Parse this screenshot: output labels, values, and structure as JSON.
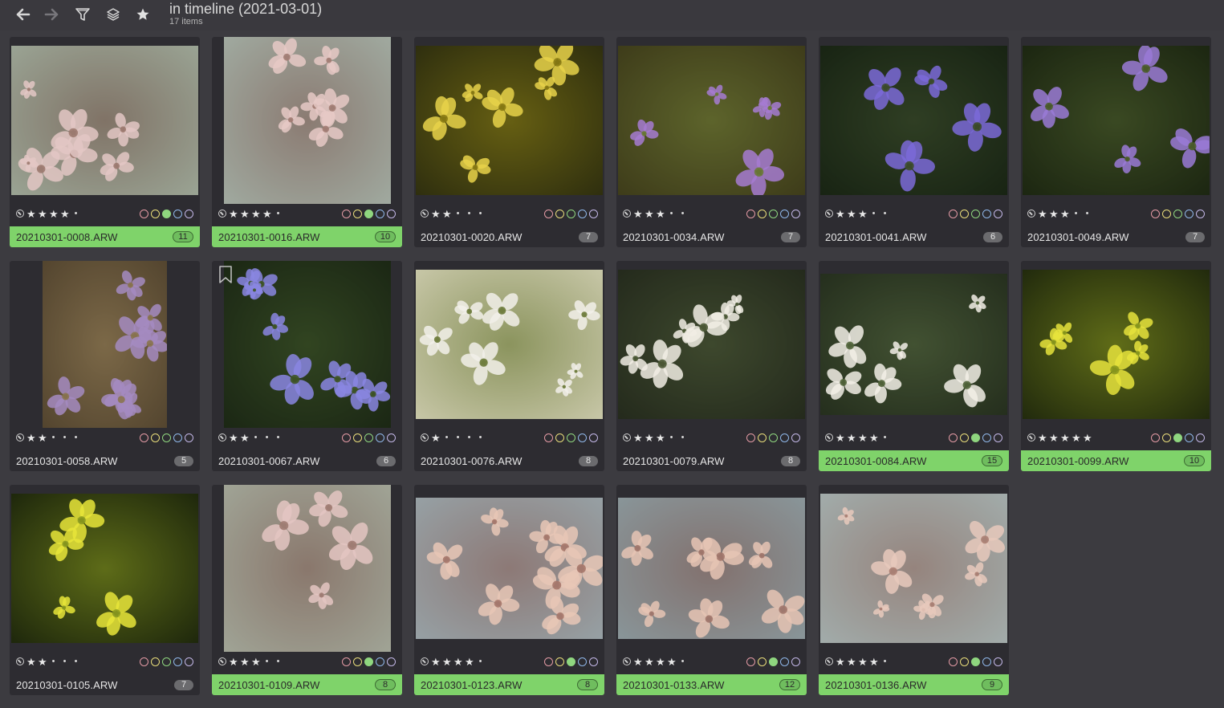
{
  "toolbar": {
    "title": "in timeline (2021-03-01)",
    "count": "17 items",
    "buttons": [
      "back-icon",
      "forward-icon",
      "filter-icon",
      "stack-icon",
      "star-icon"
    ]
  },
  "colors": {
    "background": "#3c3b40",
    "cell": "#2d2c31",
    "selected_footer": "#7fd36a",
    "label_red": "#e39aa4",
    "label_yellow": "#e8dc7a",
    "label_green": "#8fd67f",
    "label_blue": "#8fb6e8",
    "label_purple": "#c2b6e6"
  },
  "items": [
    {
      "name": "20210301-0008.ARW",
      "versions": "11",
      "rating": 4,
      "green": true,
      "selected": true,
      "bookmark": false,
      "photo": {
        "ar": "wide",
        "palette": [
          "#5e6a5a",
          "#e3c7c4",
          "#9d7a70",
          "#cfd8c8"
        ]
      }
    },
    {
      "name": "20210301-0016.ARW",
      "versions": "10",
      "rating": 4,
      "green": true,
      "selected": true,
      "bookmark": false,
      "photo": {
        "ar": "tall",
        "palette": [
          "#6e7b72",
          "#e6c9c6",
          "#a27c73",
          "#cbd6cb"
        ]
      }
    },
    {
      "name": "20210301-0020.ARW",
      "versions": "7",
      "rating": 2,
      "green": false,
      "selected": false,
      "bookmark": false,
      "photo": {
        "ar": "wide",
        "palette": [
          "#3b3d12",
          "#e7d24a",
          "#8a7b14",
          "#1e1d0c"
        ]
      }
    },
    {
      "name": "20210301-0034.ARW",
      "versions": "7",
      "rating": 3,
      "green": false,
      "selected": false,
      "bookmark": false,
      "photo": {
        "ar": "wide",
        "palette": [
          "#4d4a20",
          "#a67bd1",
          "#6a7a36",
          "#2e2d14"
        ]
      }
    },
    {
      "name": "20210301-0041.ARW",
      "versions": "6",
      "rating": 3,
      "green": false,
      "selected": false,
      "bookmark": false,
      "photo": {
        "ar": "wide",
        "palette": [
          "#1f2c1a",
          "#7b6ad8",
          "#3d4d2b",
          "#101a0c"
        ]
      }
    },
    {
      "name": "20210301-0049.ARW",
      "versions": "7",
      "rating": 3,
      "green": false,
      "selected": false,
      "bookmark": false,
      "photo": {
        "ar": "wide",
        "palette": [
          "#243018",
          "#9a7ad6",
          "#4d5d2b",
          "#131a0a"
        ]
      }
    },
    {
      "name": "20210301-0058.ARW",
      "versions": "5",
      "rating": 2,
      "green": false,
      "selected": false,
      "bookmark": false,
      "photo": {
        "ar": "portrait",
        "palette": [
          "#6b5a3e",
          "#a58bc1",
          "#8a7450",
          "#3c2f20"
        ]
      }
    },
    {
      "name": "20210301-0067.ARW",
      "versions": "6",
      "rating": 2,
      "green": false,
      "selected": false,
      "bookmark": true,
      "photo": {
        "ar": "tall",
        "palette": [
          "#22301a",
          "#8a86e2",
          "#3f5527",
          "#141c0e"
        ]
      }
    },
    {
      "name": "20210301-0076.ARW",
      "versions": "8",
      "rating": 1,
      "green": false,
      "selected": false,
      "bookmark": false,
      "photo": {
        "ar": "wide",
        "palette": [
          "#b2b48a",
          "#f2f0ea",
          "#6c7a3a",
          "#e0dcc8"
        ]
      }
    },
    {
      "name": "20210301-0079.ARW",
      "versions": "8",
      "rating": 3,
      "green": false,
      "selected": false,
      "bookmark": false,
      "photo": {
        "ar": "wide",
        "palette": [
          "#2d3424",
          "#f1ede4",
          "#4c5a36",
          "#1b2015"
        ]
      }
    },
    {
      "name": "20210301-0084.ARW",
      "versions": "15",
      "rating": 4,
      "green": true,
      "selected": true,
      "bookmark": false,
      "photo": {
        "ar": "wide2",
        "palette": [
          "#2f3a28",
          "#f2efe6",
          "#52653b",
          "#1a2213"
        ]
      }
    },
    {
      "name": "20210301-0099.ARW",
      "versions": "10",
      "rating": 5,
      "green": true,
      "selected": true,
      "bookmark": false,
      "photo": {
        "ar": "wide",
        "palette": [
          "#2a3512",
          "#e6e33c",
          "#8c9a1e",
          "#141a08"
        ]
      }
    },
    {
      "name": "20210301-0105.ARW",
      "versions": "7",
      "rating": 2,
      "green": false,
      "selected": false,
      "bookmark": false,
      "photo": {
        "ar": "wide",
        "palette": [
          "#26330f",
          "#e8e53a",
          "#8c9b20",
          "#111608"
        ]
      }
    },
    {
      "name": "20210301-0109.ARW",
      "versions": "8",
      "rating": 3,
      "green": true,
      "selected": true,
      "bookmark": false,
      "photo": {
        "ar": "tall",
        "palette": [
          "#6f7466",
          "#e4c6c2",
          "#a07b72",
          "#cbd1c2"
        ]
      }
    },
    {
      "name": "20210301-0123.ARW",
      "versions": "8",
      "rating": 4,
      "green": true,
      "selected": true,
      "bookmark": false,
      "photo": {
        "ar": "wide2",
        "palette": [
          "#6e7c84",
          "#e8c7b6",
          "#a6776a",
          "#b8c3c4"
        ]
      }
    },
    {
      "name": "20210301-0133.ARW",
      "versions": "12",
      "rating": 4,
      "green": true,
      "selected": true,
      "bookmark": false,
      "photo": {
        "ar": "wide2",
        "palette": [
          "#5d6c74",
          "#e6c4b4",
          "#a1756a",
          "#aebbbd"
        ]
      }
    },
    {
      "name": "20210301-0136.ARW",
      "versions": "9",
      "rating": 4,
      "green": true,
      "selected": true,
      "bookmark": false,
      "photo": {
        "ar": "wide",
        "palette": [
          "#7d8b8c",
          "#e8c9bc",
          "#aa7e72",
          "#c2cbc9"
        ]
      }
    }
  ]
}
